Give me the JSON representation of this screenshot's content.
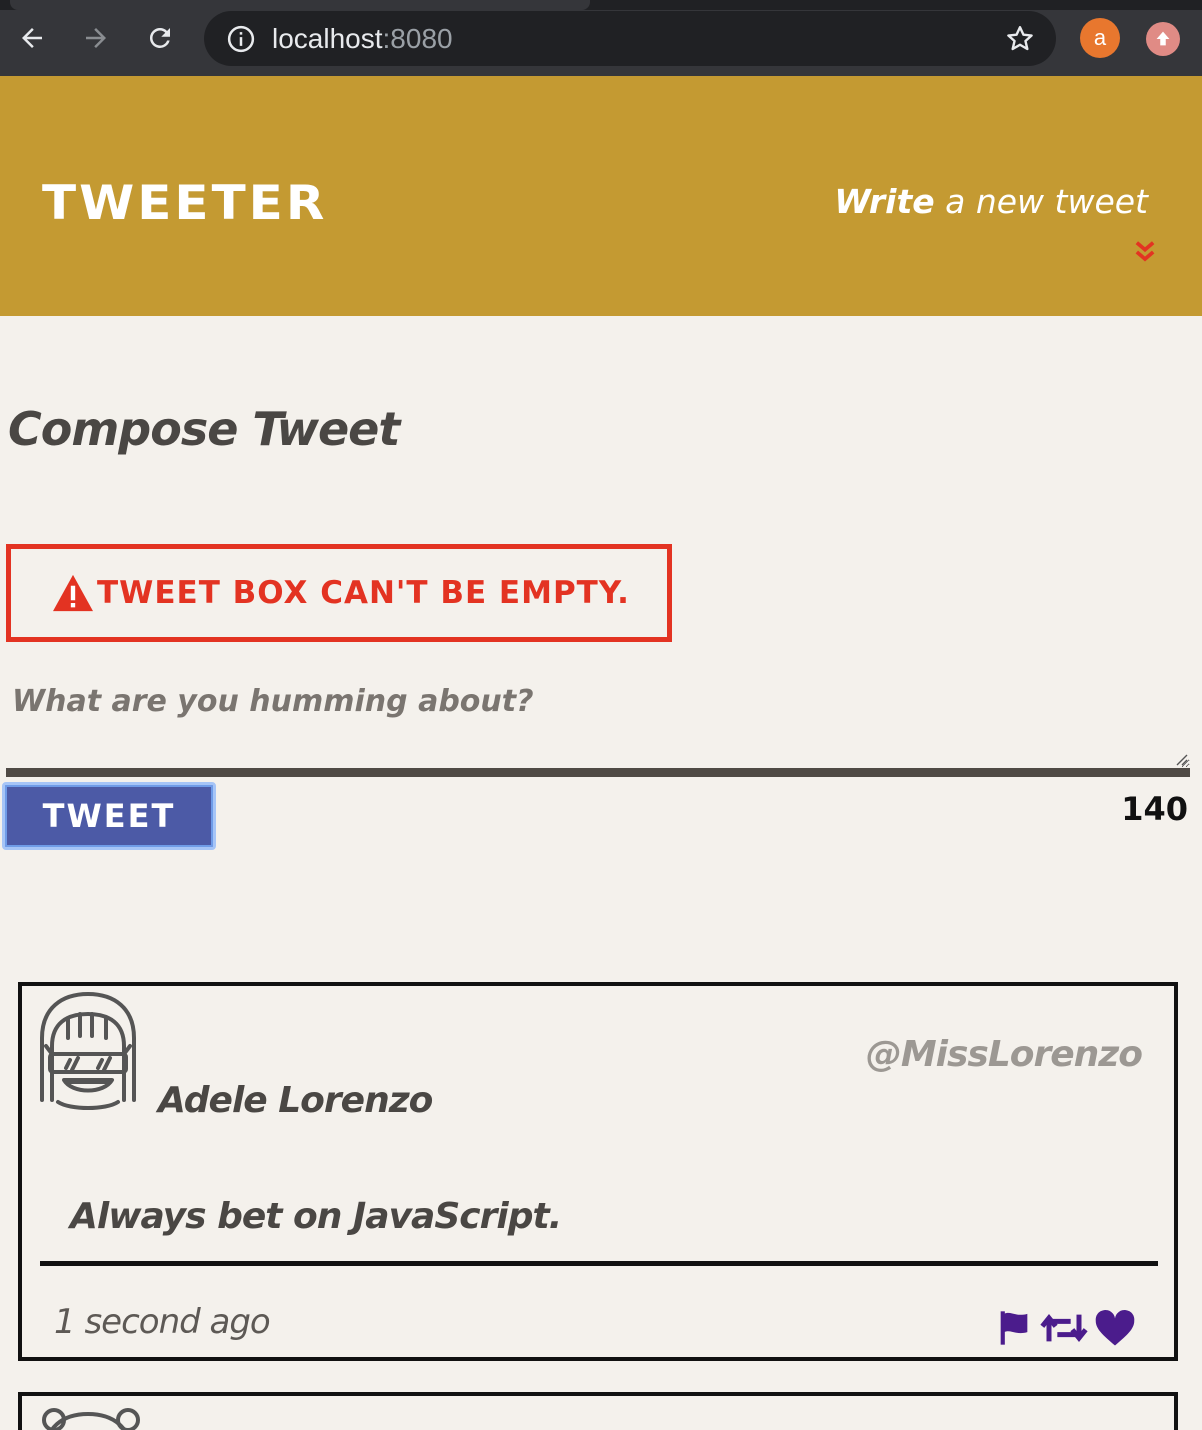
{
  "browser": {
    "url_host": "localhost",
    "url_port": ":8080",
    "profile_initial": "a"
  },
  "header": {
    "brand": "TWEETER",
    "write_bold": "Write",
    "write_rest": " a new tweet"
  },
  "compose": {
    "title": "Compose Tweet",
    "error_message": "TWEET BOX CAN'T BE EMPTY.",
    "textarea_placeholder": "What are you humming about?",
    "submit_label": "TWEET",
    "char_counter": "140"
  },
  "tweets": [
    {
      "name": "Adele Lorenzo",
      "handle": "@MissLorenzo",
      "content": "Always bet on JavaScript.",
      "time": "1 second ago"
    }
  ],
  "colors": {
    "header_bg": "#c49a32",
    "error": "#e33322",
    "button": "#4c5aa6",
    "action_icons": "#4b1c8c",
    "page_bg": "#f4f1ec"
  },
  "icons": {
    "back": "arrow-left-icon",
    "forward": "arrow-right-icon",
    "reload": "reload-icon",
    "info": "info-icon",
    "bookmark": "star-icon",
    "write_toggle": "double-chevron-down-icon",
    "error": "warning-icon",
    "flag": "flag-icon",
    "retweet": "retweet-icon",
    "like": "heart-icon"
  }
}
